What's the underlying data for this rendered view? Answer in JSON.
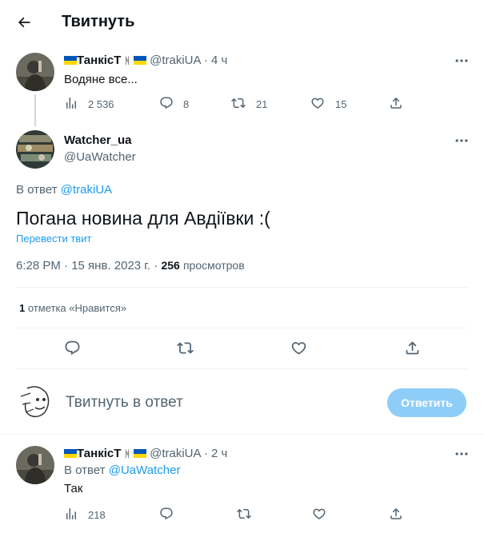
{
  "header": {
    "title": "Твитнуть"
  },
  "parent_tweet": {
    "display_name": "ТанкісТ",
    "name_symbol": "ᚻ",
    "handle": "@trakiUA",
    "separator": "·",
    "time": "4 ч",
    "text": "Водяне все...",
    "views": "2 536",
    "replies": "8",
    "retweets": "21",
    "likes": "15"
  },
  "main_tweet": {
    "display_name": "Watcher_ua",
    "handle": "@UaWatcher",
    "reply_prefix": "В ответ",
    "reply_to": "@trakiUA",
    "text": "Погана новина для Авдіївки :(",
    "translate": "Перевести твит",
    "timestamp": "6:28 PM · 15 янв. 2023 г. ·",
    "views_count": "256",
    "views_label": "просмотров",
    "likes_count": "1",
    "likes_label": "отметка «Нравится»"
  },
  "composer": {
    "placeholder": "Твитнуть в ответ",
    "button_label": "Ответить"
  },
  "reply_tweet": {
    "display_name": "ТанкісТ",
    "name_symbol": "ᚻ",
    "handle": "@trakiUA",
    "separator": "·",
    "time": "2 ч",
    "reply_prefix": "В ответ",
    "reply_to": "@UaWatcher",
    "text": "Так",
    "views": "218"
  },
  "colors": {
    "accent": "#1d9bf0",
    "muted": "#536471",
    "reply_button_disabled": "#8ecdf8",
    "flag_blue": "#0057b7",
    "flag_yellow": "#ffd700"
  }
}
